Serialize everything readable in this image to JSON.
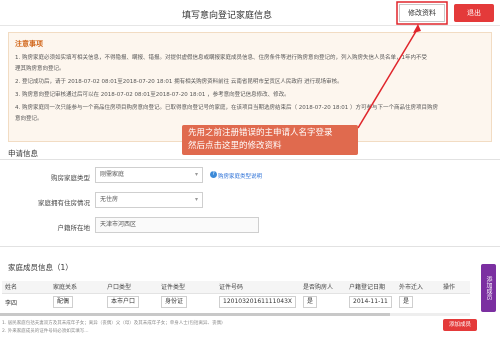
{
  "header": {
    "title": "填写意向登记家庭信息",
    "edit_button": "修改资料",
    "exit_button": "退出"
  },
  "notice": {
    "title": "注意事项",
    "lines": [
      "1. 购房家庭必须如实填写相关信息，不得隐报、瞒报、错报。对提供虚假信息或瞒报家庭成员信息、住房条件等进行购房意向登记的，列入购房失信人员名单，1年内不受",
      "理其购房意向登记。",
      "2. 登记成功后，请于 2018-07-02 08:01至2018-07-20 18:01 拥有相关购房资料前往 云南省昆明市呈贡区人民政府 进行现场审核。",
      "3. 购房意向登记审核通过后可以在 2018-07-02 08:01至2018-07-20 18:01 ，参考意向登记信息修改、修改。",
      "4. 购房家庭同一次只能参与一个商品住房项目购房意向登记。已取得意向登记号的家庭，在该项目当期选房结束后（ 2018-07-20 18:01 ）方可参与下一个商品住房项目购房",
      "意向登记。"
    ]
  },
  "callout": {
    "line1": "先用之前注册错误的主申请人名字登录",
    "line2": "然后点击这里的修改资料"
  },
  "application": {
    "section_title": "申请信息",
    "purchase_type_label": "购房家庭类型",
    "purchase_type_value": "刚需家庭",
    "help_icon": "?",
    "help_link": "购房家庭类型说明",
    "housing_label": "家庭拥有住房情况",
    "housing_value": "无住房",
    "hukou_label": "户籍所在地",
    "hukou_value": "天津市河西区"
  },
  "members": {
    "section_title": "家庭成员信息（1）",
    "columns": [
      "姓名",
      "家庭关系",
      "户口类型",
      "证件类型",
      "证件号码",
      "是否购房人",
      "户籍登记日期",
      "外市迁入",
      "操作"
    ],
    "rows": [
      [
        "李四",
        "配偶",
        "本市户口",
        "身份证",
        "120103201611110​43X",
        "是",
        "2014-11-11",
        "是",
        ""
      ]
    ],
    "footnote1": "1. 居民家庭包括夫妻双方及其未成年子女；离异（丧偶）父（母）及其未成年子女；单身人士(包括离异、丧偶)",
    "footnote2": "2. 外来家庭成员的证件号码必须如实填写...",
    "add_member_button": "添加成员",
    "side_button": "添加成员"
  }
}
